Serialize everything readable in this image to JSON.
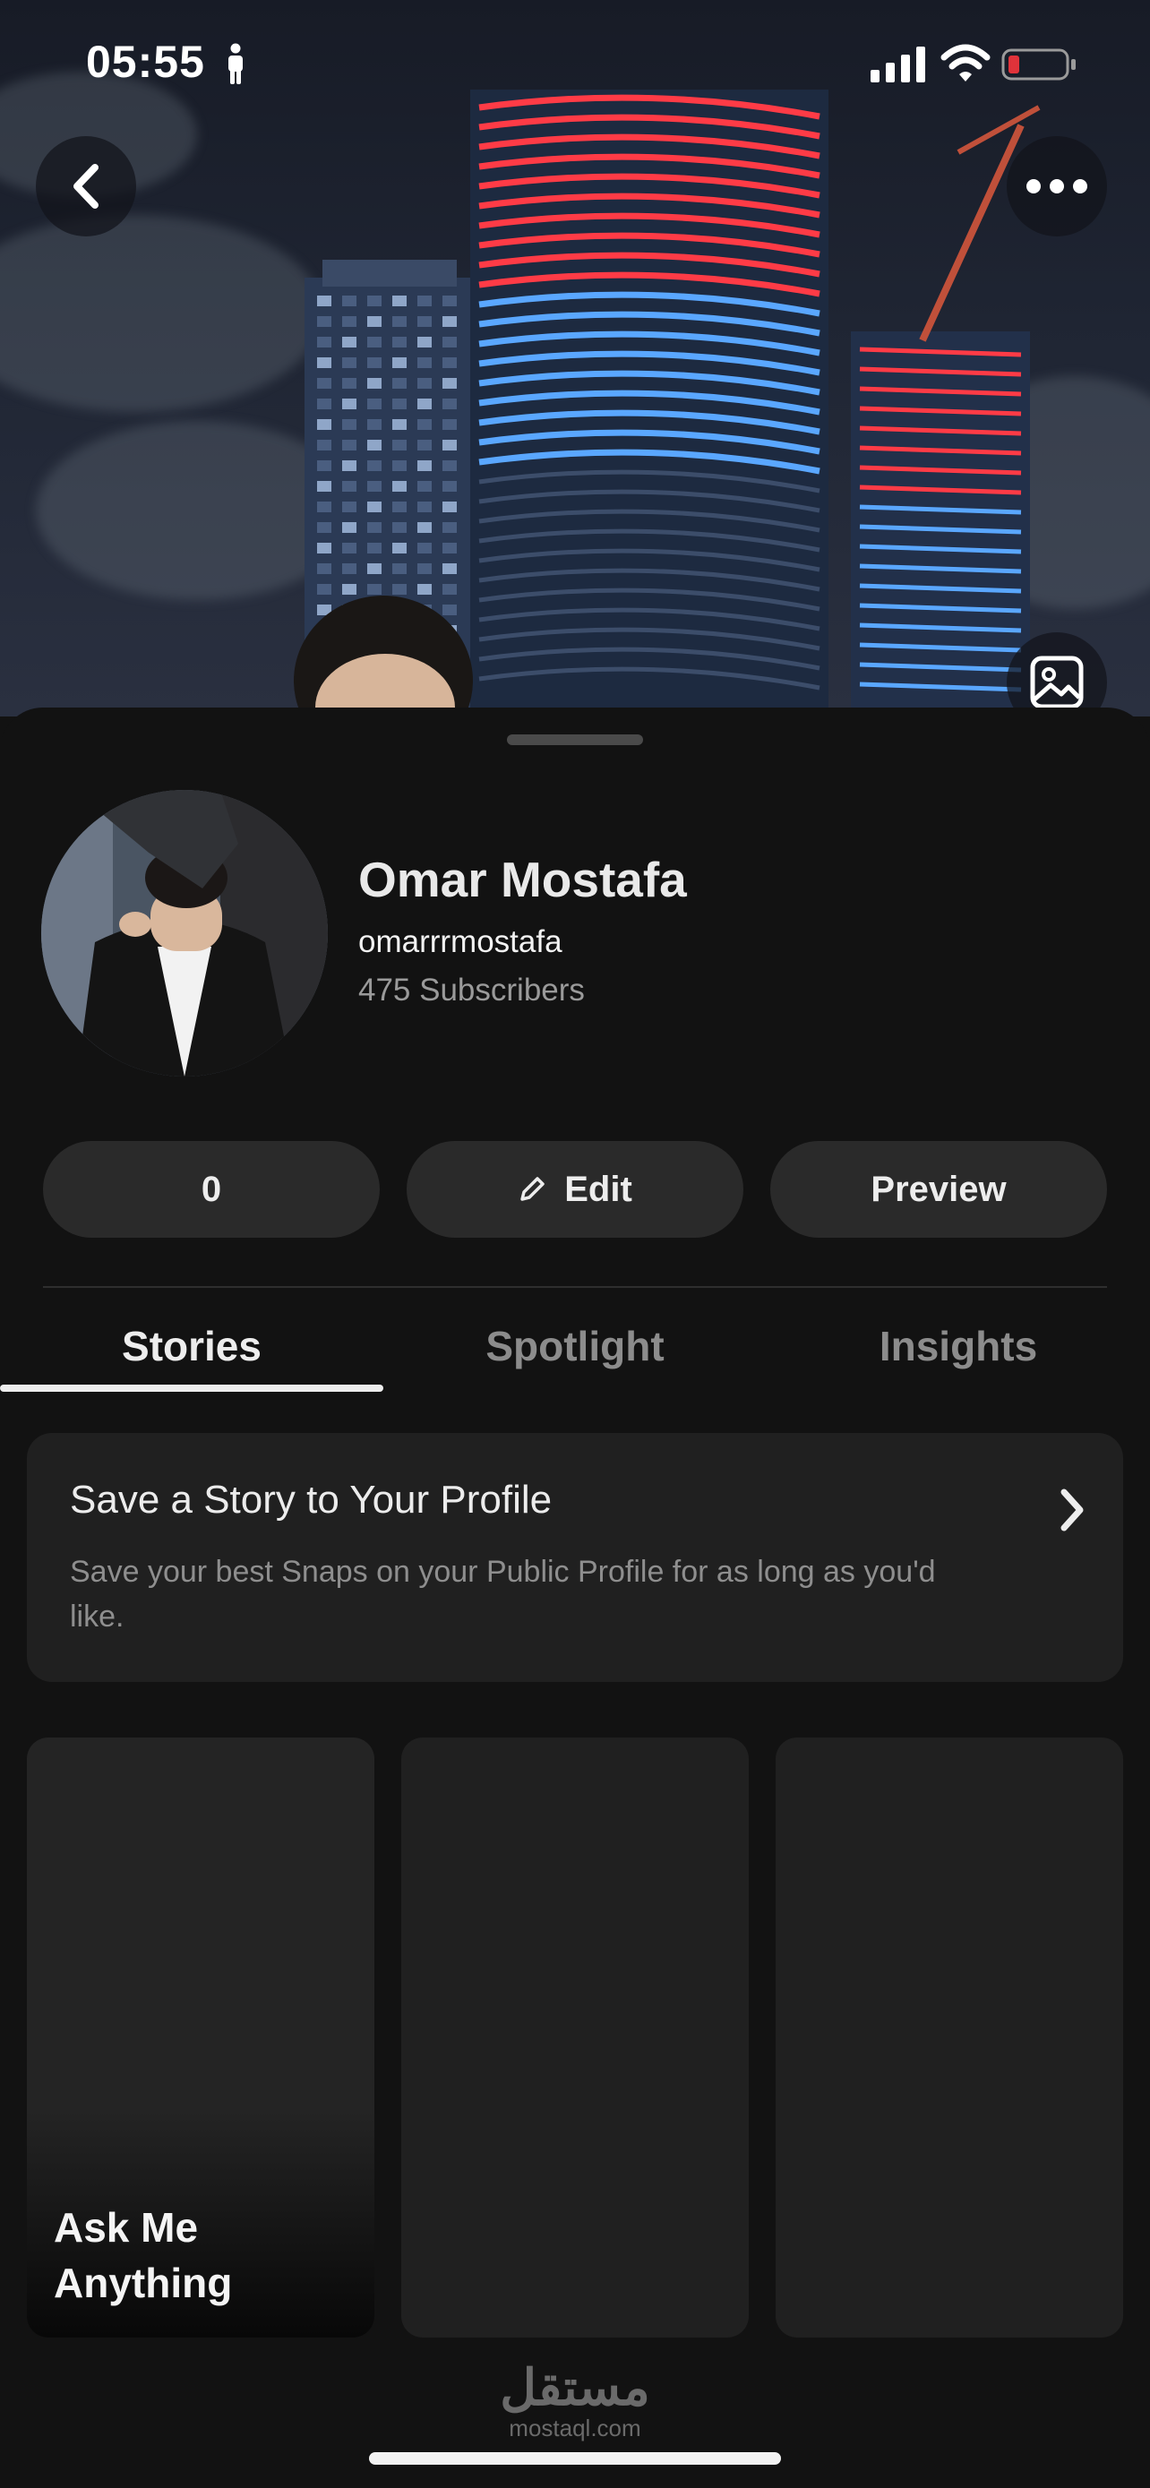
{
  "status_bar": {
    "time": "05:55",
    "icons": [
      "person-icon",
      "signal-icon",
      "wifi-icon",
      "battery-icon"
    ],
    "battery_color": "#e0333a"
  },
  "header": {
    "back_icon": "chevron-left-icon",
    "more_icon": "more-horizontal-icon",
    "change_cover_icon": "image-icon"
  },
  "profile": {
    "name": "Omar Mostafa",
    "username": "omarrrmostafa",
    "subscribers": "475 Subscribers"
  },
  "actions": {
    "count_label": "0",
    "edit_label": "Edit",
    "edit_icon": "pencil-icon",
    "preview_label": "Preview"
  },
  "tabs": [
    {
      "label": "Stories",
      "active": true
    },
    {
      "label": "Spotlight",
      "active": false
    },
    {
      "label": "Insights",
      "active": false
    }
  ],
  "save_story_card": {
    "title": "Save a Story to Your Profile",
    "description": "Save your best Snaps on your Public Profile for as long as you'd like.",
    "icon": "chevron-right-icon"
  },
  "tiles": [
    {
      "label": "Ask Me Anything"
    },
    {
      "label": ""
    },
    {
      "label": ""
    }
  ],
  "watermark": {
    "arabic": "مستقل",
    "latin": "mostaql.com"
  },
  "colors": {
    "background": "#121212",
    "surface": "#202020",
    "pill": "#2a2a2a",
    "tower_red": "#ff3b46",
    "tower_blue": "#5aa7ff"
  }
}
